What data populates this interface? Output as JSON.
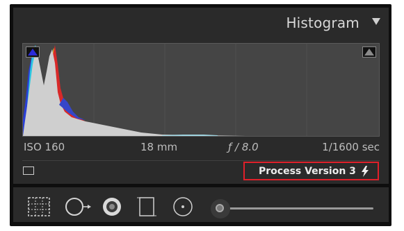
{
  "panel": {
    "title": "Histogram",
    "collapse_icon": "triangle-down-icon"
  },
  "histogram": {
    "shadow_clip_indicator": "blue-triangle-icon",
    "highlight_clip_indicator": "gray-triangle-icon"
  },
  "exif": {
    "iso": "ISO 160",
    "focal_length": "18 mm",
    "aperture": "ƒ / 8.0",
    "shutter": "1/1600 sec"
  },
  "process": {
    "label": "Process Version 3",
    "icon": "lightning-bolt-icon",
    "highlight_color": "#e0202a"
  },
  "original_photo_icon": "rectangle-icon",
  "toolbar": {
    "tools": [
      "crop-overlay-icon",
      "spot-removal-icon",
      "red-eye-icon",
      "graduated-filter-icon",
      "radial-filter-icon"
    ],
    "slider_icon": "adjustment-brush-slider-icon"
  }
}
